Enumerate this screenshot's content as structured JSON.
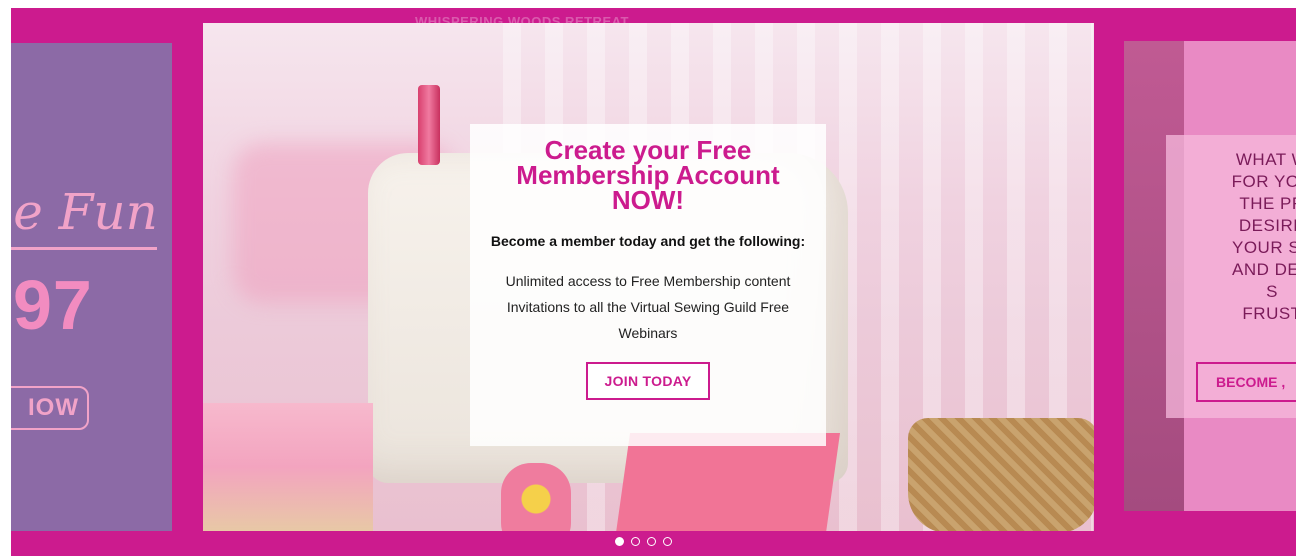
{
  "banner": {
    "title": "WHISPERING WOODS RETREAT"
  },
  "slide_left": {
    "script_text": "he Fun",
    "price": "97",
    "button_label": "IOW"
  },
  "slide_center": {
    "title": "Create your Free Membership Account NOW!",
    "subtitle": "Become a member today and get the following:",
    "benefit_1": "Unlimited access to Free Membership content",
    "benefit_2": "Invitations to all the Virtual Sewing Guild Free Webinars",
    "button_label": "JOIN TODAY"
  },
  "slide_right": {
    "lines": [
      "WHAT W",
      "FOR YOU",
      "THE PR",
      "DESIRE",
      "YOUR SE",
      "AND DEC",
      "S",
      "FRUST"
    ],
    "button_label": "BECOME ,"
  },
  "carousel": {
    "slide_count": 4,
    "active_index": 0
  },
  "colors": {
    "brand": "#cc1b8e",
    "left_slide": "#8c6aa6",
    "right_slide": "#e98ac4"
  }
}
